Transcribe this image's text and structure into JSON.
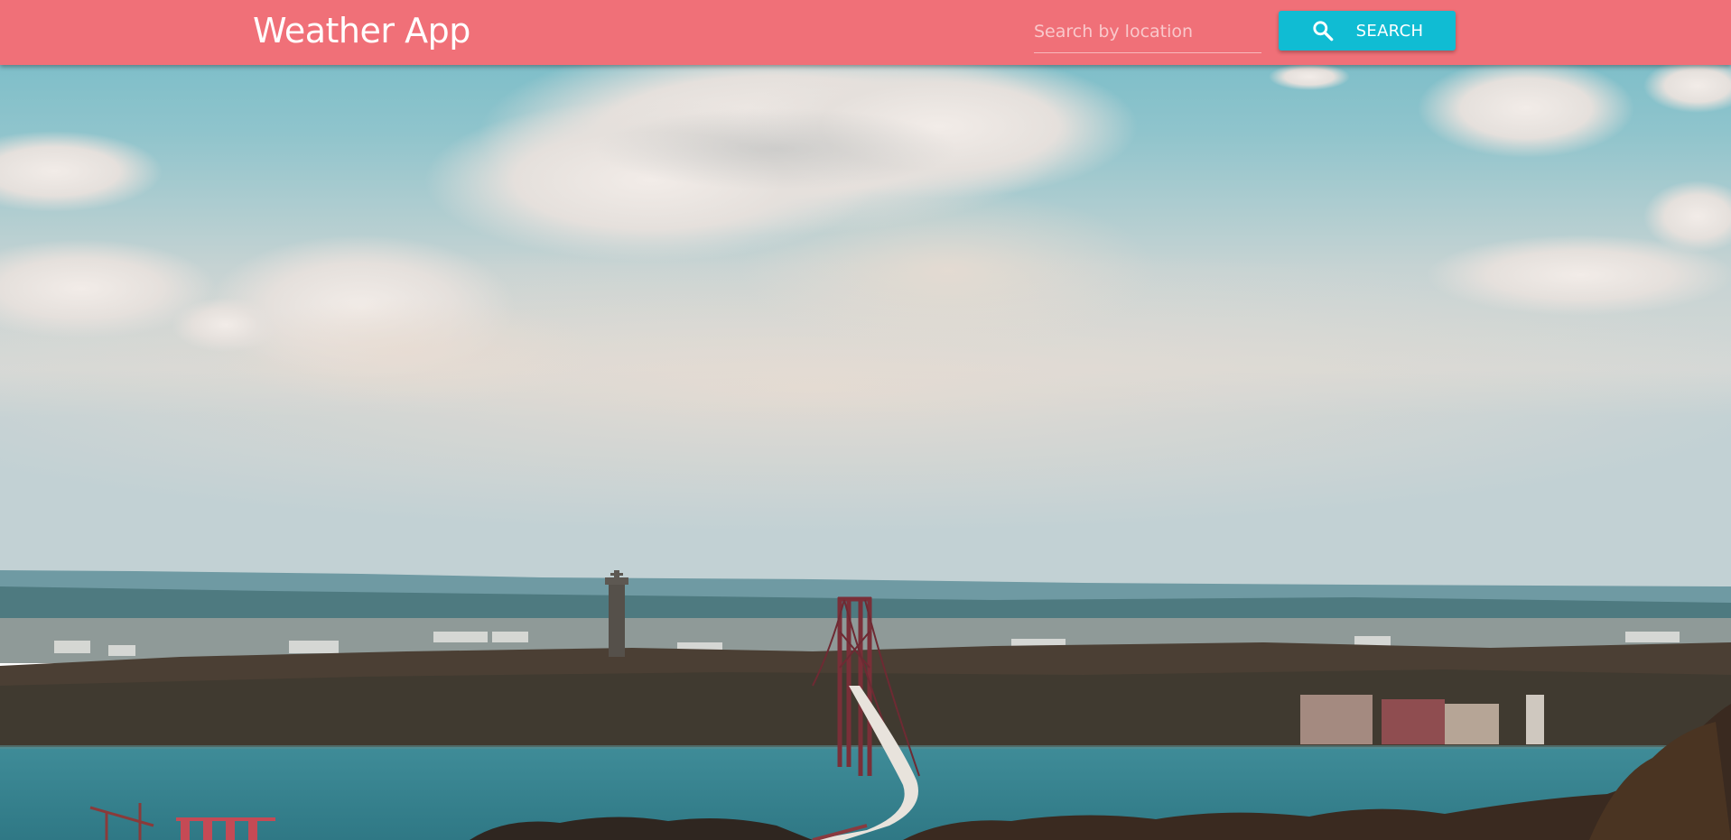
{
  "header": {
    "title": "Weather App",
    "bar_color": "#f07078"
  },
  "search": {
    "placeholder": "Search by location",
    "value": "",
    "button_label": "SEARCH",
    "button_icon": "search-icon",
    "button_color": "#10bcd3"
  },
  "background": {
    "scene": "landscape-photo"
  }
}
